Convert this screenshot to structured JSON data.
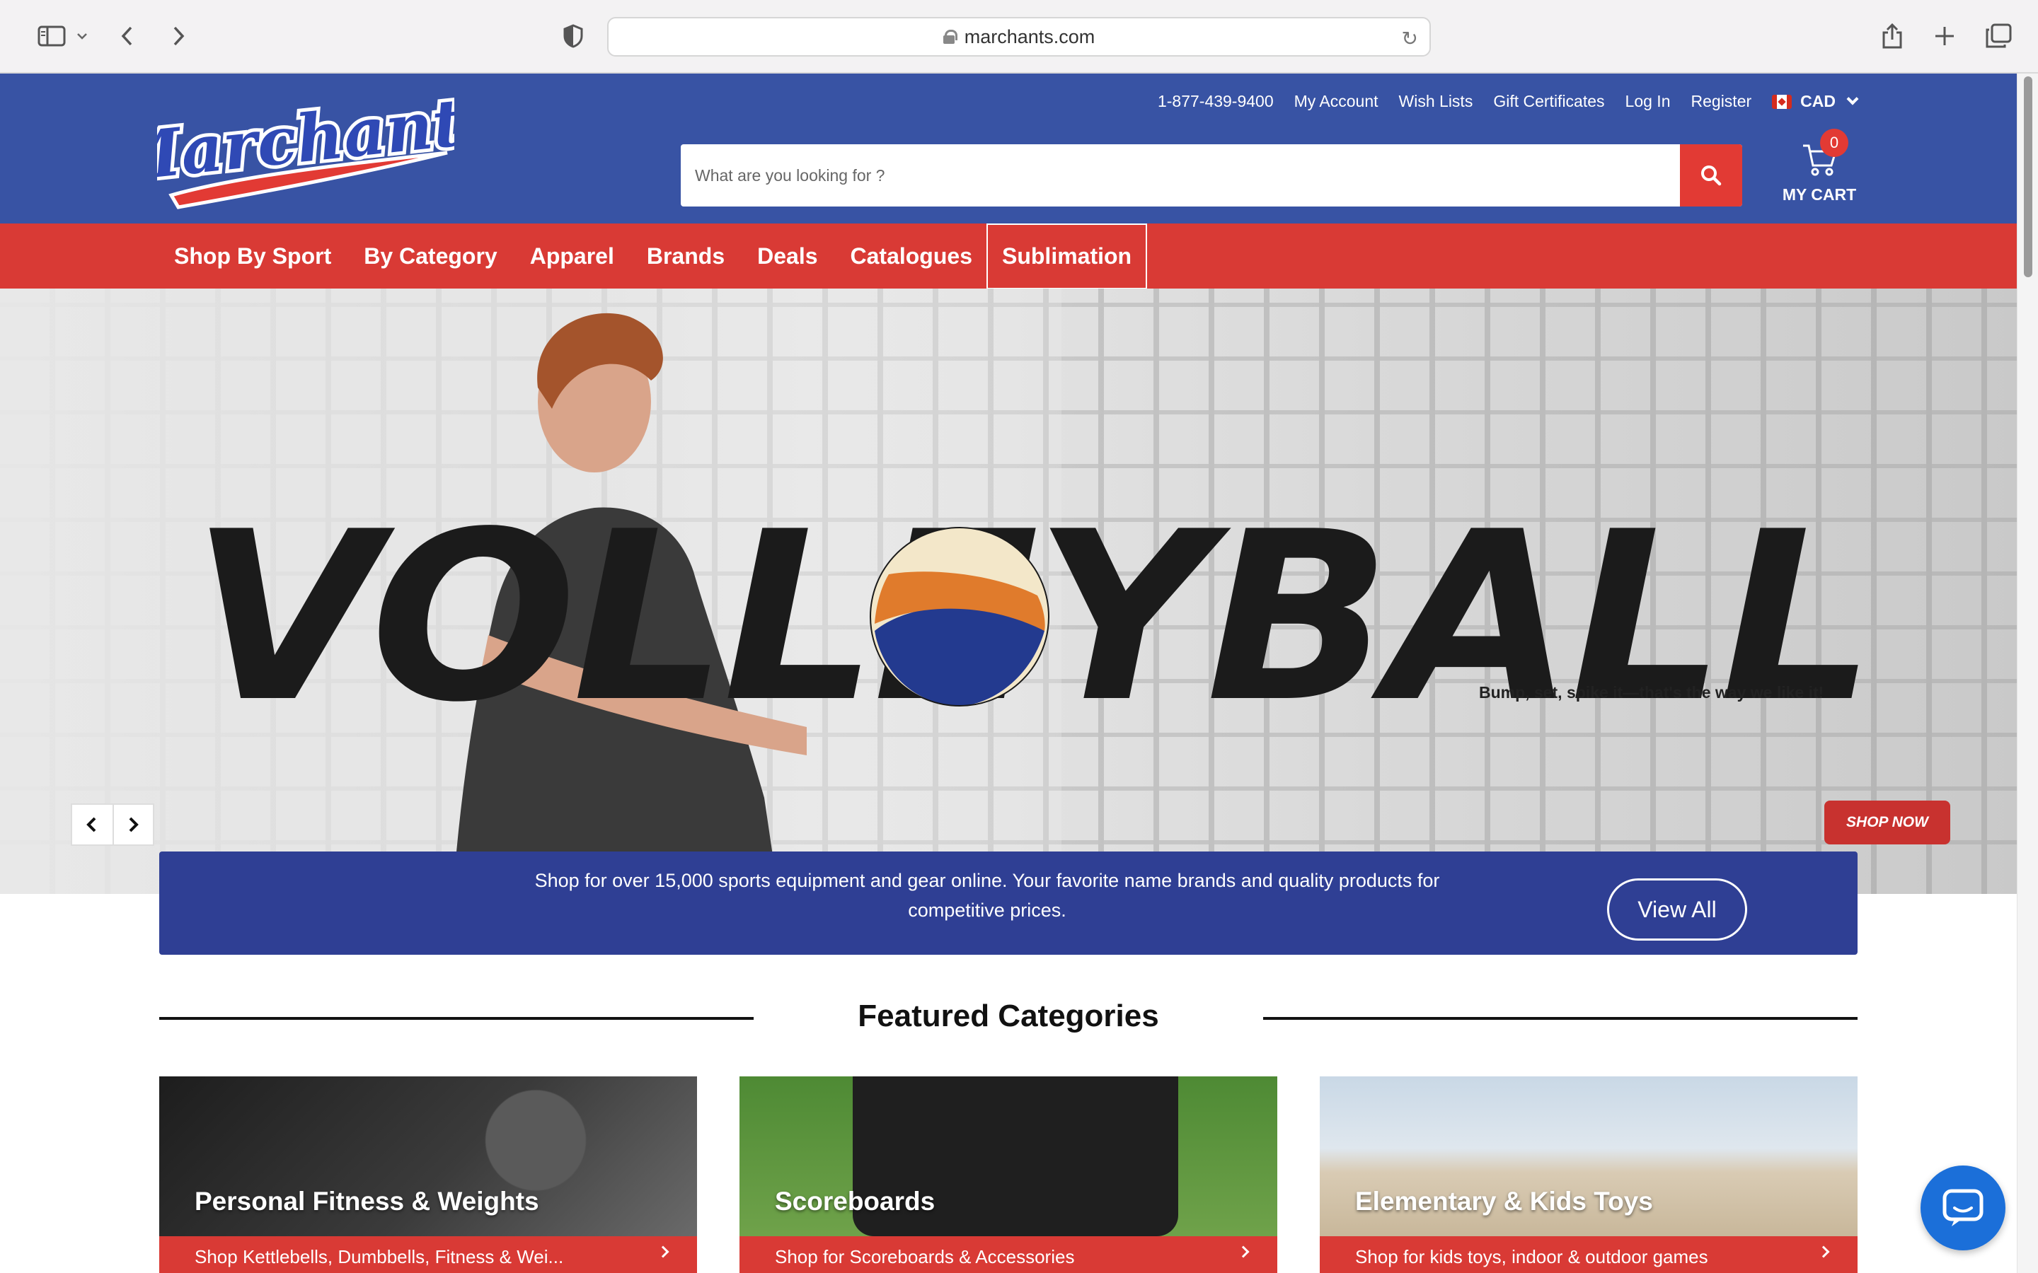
{
  "browser": {
    "url": "marchants.com"
  },
  "header": {
    "logo_text": "Marchants",
    "phone": "1-877-439-9400",
    "links": [
      "My Account",
      "Wish Lists",
      "Gift Certificates",
      "Log In",
      "Register"
    ],
    "currency": "CAD",
    "search_placeholder": "What are you looking for ?",
    "cart_count": "0",
    "cart_label": "MY CART",
    "colors": {
      "header_bg": "#3853a4",
      "accent_red": "#d93a35"
    }
  },
  "nav": {
    "items": [
      "Shop By Sport",
      "By Category",
      "Apparel",
      "Brands",
      "Deals",
      "Catalogues",
      "Sublimation"
    ]
  },
  "hero": {
    "headline": "VOLLEYBALL",
    "tagline": "Bump, set, spike it—that's the way we like it!",
    "cta": "SHOP NOW"
  },
  "banner": {
    "text": "Shop for over 15,000 sports equipment and gear online. Your favorite name brands and quality products for competitive prices.",
    "button": "View All"
  },
  "featured": {
    "title": "Featured Categories",
    "cards": [
      {
        "title": "Personal Fitness & Weights",
        "link": "Shop Kettlebells, Dumbbells, Fitness & Wei..."
      },
      {
        "title": "Scoreboards",
        "link": "Shop for Scoreboards & Accessories"
      },
      {
        "title": "Elementary & Kids Toys",
        "link": "Shop for kids toys, indoor & outdoor games"
      }
    ]
  }
}
